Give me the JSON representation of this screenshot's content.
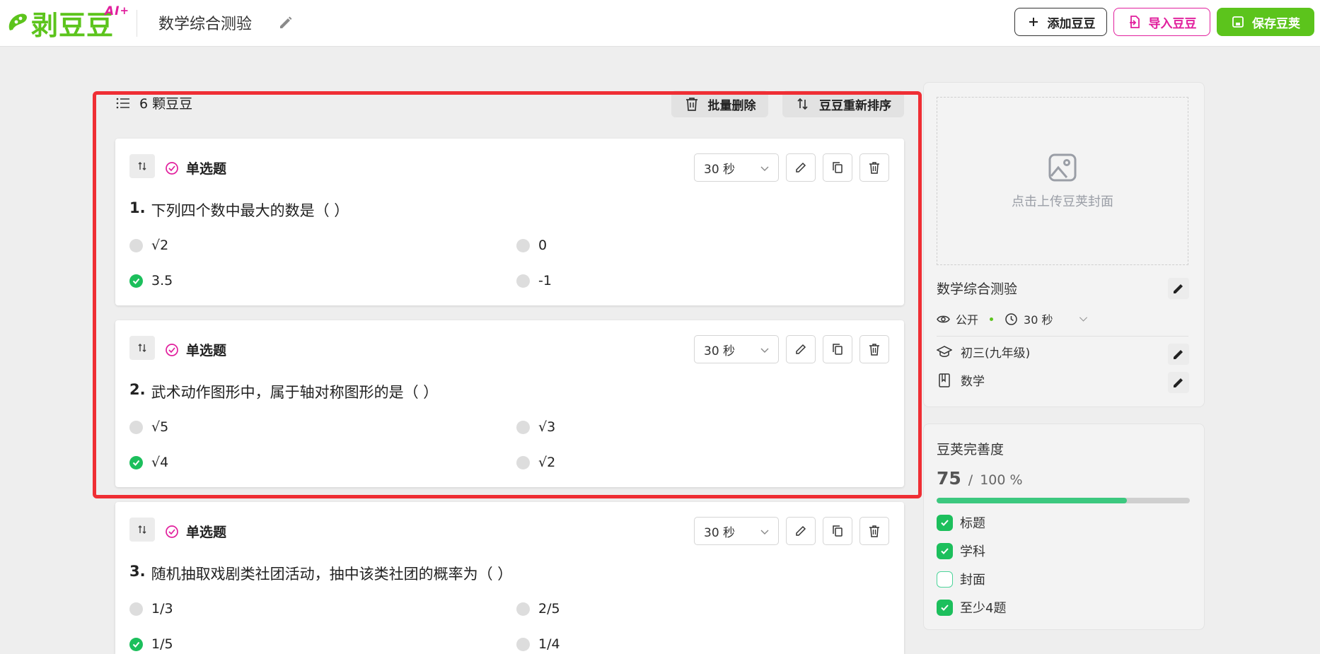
{
  "app": {
    "logo_text": "剥豆豆",
    "logo_badge": "AI",
    "logo_badge_plus": "+",
    "quiz_title": "数学综合测验"
  },
  "toolbar": {
    "add_label": "添加豆豆",
    "import_label": "导入豆豆",
    "save_label": "保存豆荚"
  },
  "list": {
    "count_label": "6 颗豆豆",
    "batch_delete_label": "批量删除",
    "reorder_label": "豆豆重新排序"
  },
  "cards": [
    {
      "type": "单选题",
      "time": "30 秒",
      "number": "1.",
      "question": "下列四个数中最大的数是（ ）",
      "options": [
        {
          "text": "√2",
          "correct": false
        },
        {
          "text": "0",
          "correct": false
        },
        {
          "text": "3.5",
          "correct": true
        },
        {
          "text": "-1",
          "correct": false
        }
      ]
    },
    {
      "type": "单选题",
      "time": "30 秒",
      "number": "2.",
      "question": "武术动作图形中，属于轴对称图形的是（ ）",
      "options": [
        {
          "text": "√5",
          "correct": false
        },
        {
          "text": "√3",
          "correct": false
        },
        {
          "text": "√4",
          "correct": true
        },
        {
          "text": "√2",
          "correct": false
        }
      ]
    },
    {
      "type": "单选题",
      "time": "30 秒",
      "number": "3.",
      "question": "随机抽取戏剧类社团活动，抽中该类社团的概率为（ ）",
      "options": [
        {
          "text": "1/3",
          "correct": false
        },
        {
          "text": "2/5",
          "correct": false
        },
        {
          "text": "1/5",
          "correct": true
        },
        {
          "text": "1/4",
          "correct": false
        }
      ]
    }
  ],
  "side": {
    "cover_label": "点击上传豆荚封面",
    "title": "数学综合测验",
    "visibility": "公开",
    "time": "30 秒",
    "grade": "初三(九年级)",
    "subject": "数学"
  },
  "progress": {
    "title": "豆荚完善度",
    "value": "75",
    "separator": "/",
    "total": "100 %",
    "fraction": 0.75,
    "checks": [
      {
        "label": "标题",
        "done": true
      },
      {
        "label": "学科",
        "done": true
      },
      {
        "label": "封面",
        "done": false
      },
      {
        "label": "至少4题",
        "done": true
      }
    ]
  },
  "colors": {
    "brand_green": "#5cc41c",
    "brand_pink": "#e11f9d",
    "correct_green": "#1cbf5c",
    "highlight_red": "#ef2e34",
    "progress_green": "#3cc87f"
  }
}
